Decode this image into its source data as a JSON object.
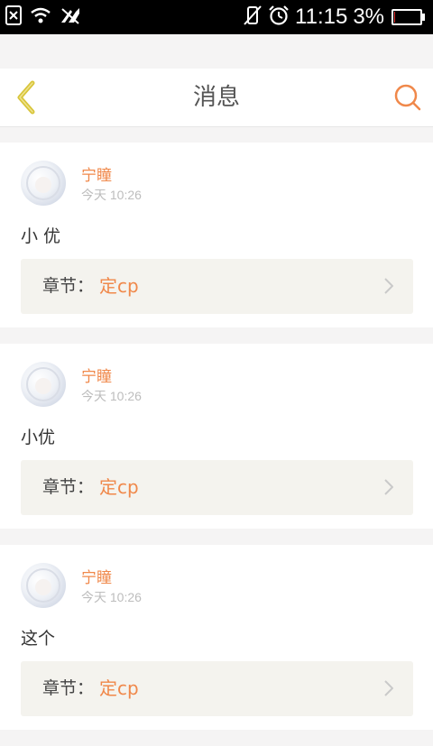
{
  "status_bar": {
    "time": "11:15",
    "battery_percent_text": "3%",
    "battery_level": 0.03,
    "icons": [
      "sim-blocked-icon",
      "wifi-icon",
      "data-off-icon",
      "vibrate-mute-icon",
      "alarm-icon",
      "battery-icon"
    ]
  },
  "header": {
    "title": "消息",
    "back_icon": "chevron-left-icon",
    "search_icon": "search-icon"
  },
  "colors": {
    "accent": "#f0884a",
    "back_arrow": "#d8c53a",
    "page_bg": "#f5f4f4",
    "chapter_bg": "#f4f3ee"
  },
  "messages": [
    {
      "username": "宁瞳",
      "time": "今天 10:26",
      "content": "小 优",
      "chapter_label": "章节：",
      "chapter_name": "定cp"
    },
    {
      "username": "宁瞳",
      "time": "今天 10:26",
      "content": "小优",
      "chapter_label": "章节：",
      "chapter_name": "定cp"
    },
    {
      "username": "宁瞳",
      "time": "今天 10:26",
      "content": "这个",
      "chapter_label": "章节：",
      "chapter_name": "定cp"
    }
  ]
}
